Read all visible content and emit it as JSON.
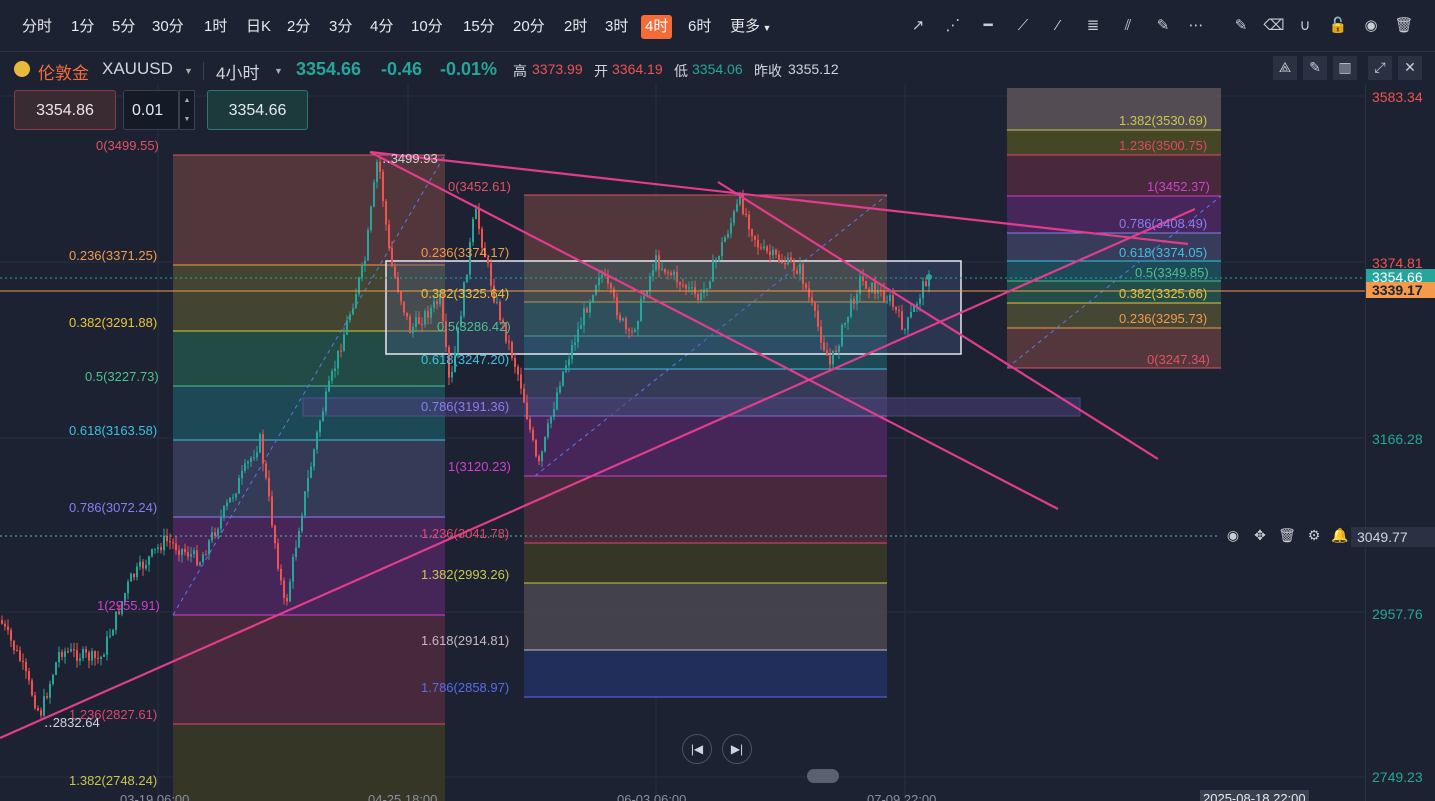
{
  "toolbar": {
    "timeframes": [
      "分时",
      "1分",
      "5分",
      "30分",
      "1时",
      "日K",
      "2分",
      "3分",
      "4分",
      "10分",
      "15分",
      "20分",
      "2时",
      "3时",
      "4时",
      "6时",
      "更多"
    ],
    "active_timeframe": "4时"
  },
  "symbol": {
    "exchange": "伦敦金",
    "code": "XAUUSD",
    "interval": "4小时",
    "price": "3354.66",
    "change": "-0.46",
    "change_pct": "-0.01%",
    "high_label": "高",
    "high": "3373.99",
    "open_label": "开",
    "open": "3364.19",
    "low_label": "低",
    "low": "3354.06",
    "prev_close_label": "昨收",
    "prev_close": "3355.12"
  },
  "order": {
    "sell_price": "3354.86",
    "quantity": "0.01",
    "buy_price": "3354.66"
  },
  "price_scale": [
    "3583.34",
    "3374.81",
    "3354.66",
    "3339.17",
    "3166.28",
    "3049.77",
    "2957.76",
    "2749.23"
  ],
  "crosshair_price": "3049.77",
  "time_axis": [
    "03-19 06:00",
    "04-25 18:00",
    "06-03 06:00",
    "07-09 22:00",
    "2025-08-18 22:00"
  ],
  "fib1": [
    "0(3499.55)",
    "0.236(3371.25)",
    "0.382(3291.88)",
    "0.5(3227.73)",
    "0.618(3163.58)",
    "0.786(3072.24)",
    "1(2955.91)",
    "1.236(2827.61)",
    "1.382(2748.24)"
  ],
  "fib2": [
    "0(3452.61)",
    "0.236(3374.17)",
    "0.382(3325.64)",
    "0.5(3286.42)",
    "0.618(3247.20)",
    "0.786(3191.36)",
    "1(3120.23)",
    "1.236(3041.78)",
    "1.382(2993.26)",
    "1.618(2914.81)",
    "1.786(2858.97)"
  ],
  "fib3": [
    "1.382(3530.69)",
    "1.236(3500.75)",
    "1(3452.37)",
    "0.786(3408.49)",
    "0.618(3374.05)",
    "0.5(3349.85)",
    "0.382(3325.66)",
    "0.236(3295.73)",
    "0(3247.34)"
  ],
  "chart_labels": {
    "high_marker": "3499.93",
    "low_marker": "2832.64"
  },
  "colors": {
    "up": "#26a69a",
    "down": "#ef5350",
    "accent": "#f46b3a",
    "trendline": "#e23c8c"
  }
}
